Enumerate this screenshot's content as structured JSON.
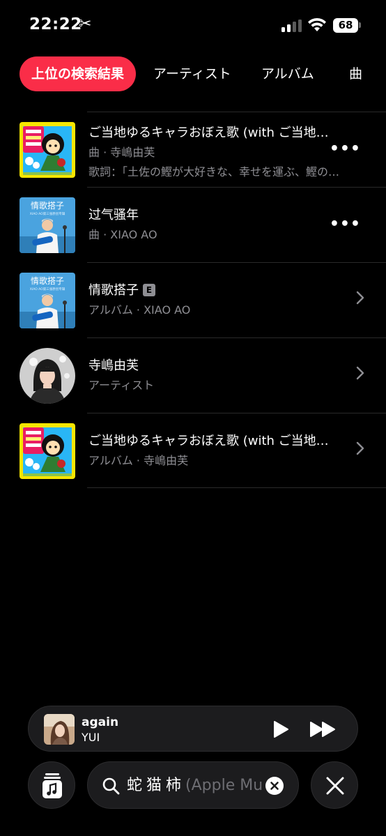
{
  "status_bar": {
    "time": "22:22",
    "scissors_glyph": "✂",
    "battery": "68"
  },
  "tabs": [
    {
      "label": "上位の検索結果",
      "active": true
    },
    {
      "label": "アーティスト",
      "active": false
    },
    {
      "label": "アルバム",
      "active": false
    },
    {
      "label": "曲",
      "active": false
    }
  ],
  "results": [
    {
      "title": "ご当地ゆるキャラおぼえ歌 (with ご当地ゆるキャラ)",
      "subtitle": "曲 · 寺嶋由芙",
      "lyrics": "歌詞：「土佐の鰹が大好きな、幸せを運ぶ、鰹のキャラクター」",
      "action": "more",
      "art": "mascot-cover"
    },
    {
      "title": "过气骚年",
      "subtitle": "曲 · XIAO AO",
      "action": "more",
      "art": "qingge-cover"
    },
    {
      "title": "情歌搭子",
      "badge": "E",
      "subtitle": "アルバム · XIAO AO",
      "action": "chevron",
      "art": "qingge-cover"
    },
    {
      "title": "寺嶋由芙",
      "subtitle": "アーティスト",
      "action": "chevron",
      "art": "artist-portrait"
    },
    {
      "title": "ご当地ゆるキャラおぼえ歌 (with ご当地ゆるキャラ)",
      "subtitle": "アルバム · 寺嶋由芙",
      "action": "chevron",
      "art": "mascot-cover"
    }
  ],
  "cover_text": {
    "qingge_title": "情歌搭子",
    "qingge_subtitle": "XIAO AO第三张原创专辑"
  },
  "mini_player": {
    "title": "again",
    "artist": "YUI"
  },
  "search": {
    "query": "蛇猫柿",
    "placeholder_tail": "(Apple Music)"
  },
  "colors": {
    "accent": "#fa2d48",
    "background": "#000000",
    "secondary_text": "#8e8e93"
  }
}
